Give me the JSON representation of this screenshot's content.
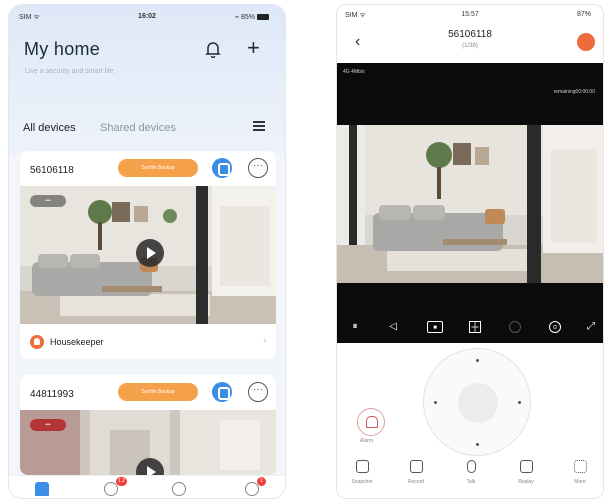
{
  "left_phone": {
    "status": {
      "carrier": "SIM ᯤ",
      "time": "16:02",
      "battery": "⌁ 85%"
    },
    "header": {
      "title": "My home",
      "subtitle": "Live a security and smart life"
    },
    "tabs": {
      "all": "All devices",
      "shared": "Shared devices"
    },
    "devices": [
      {
        "id": "56106118",
        "action_label": "Sunfile Backup",
        "live_badge": "•••",
        "room": "Housekeeper"
      },
      {
        "id": "44811993",
        "action_label": "Sunfile Backup",
        "live_badge": "•••"
      }
    ],
    "nav": {
      "badge_cloud": "1.2",
      "badge_me": "1"
    }
  },
  "right_phone": {
    "status": {
      "carrier": "SIM ᯤ",
      "time": "15:57",
      "battery": "87%"
    },
    "title": "56106118",
    "subtitle": "(1/38)",
    "video": {
      "signal_text": "4G 4Mb/s",
      "remaining_text": "remaining00:00:00"
    },
    "alarm_label": "Alarm",
    "toolbar": [
      {
        "label": "Snapshot"
      },
      {
        "label": "Record"
      },
      {
        "label": "Talk"
      },
      {
        "label": "Replay"
      },
      {
        "label": "More"
      }
    ]
  },
  "colors": {
    "accent_blue": "#3c8de6",
    "accent_orange": "#f5a04a",
    "brand_red": "#ee6b3b"
  }
}
